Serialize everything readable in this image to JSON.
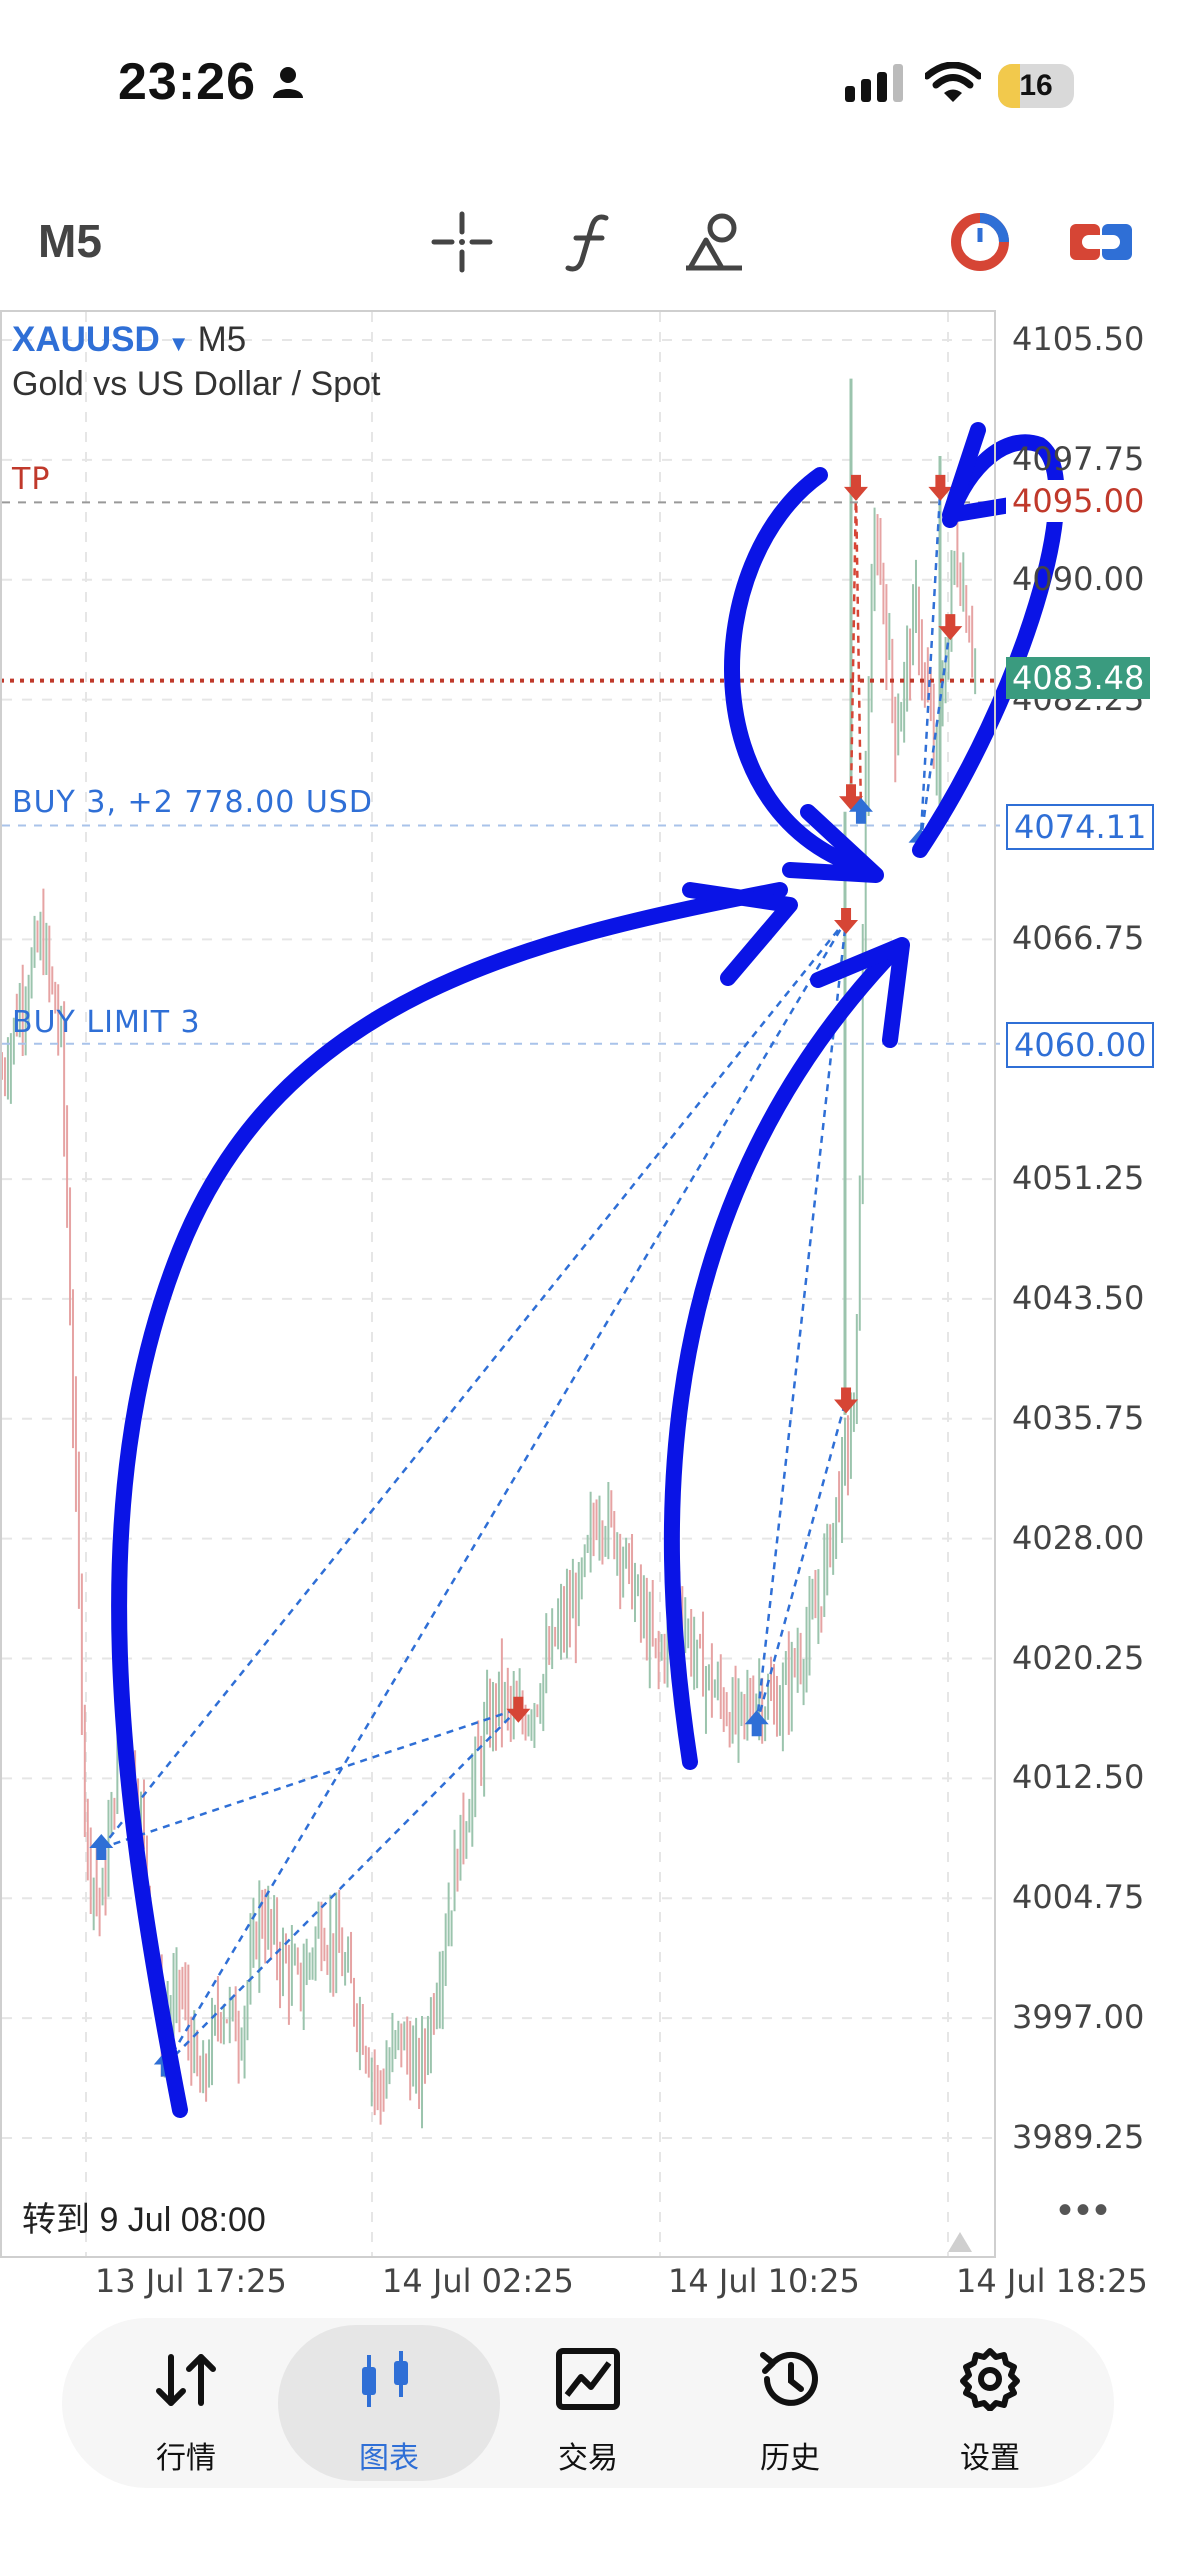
{
  "status_bar": {
    "time": "23:26",
    "battery": "16",
    "icons": [
      "person-icon",
      "cellular-signal-icon",
      "wifi-icon",
      "battery-icon"
    ]
  },
  "toolbar": {
    "timeframe": "M5",
    "icons": [
      "crosshair-icon",
      "indicators-icon",
      "objects-icon",
      "one-click-trading-icon",
      "chart-settings-icon"
    ]
  },
  "chart": {
    "symbol": "XAUUSD",
    "symbol_arrow": "▼",
    "timeframe": "M5",
    "description": "Gold vs US Dollar / Spot",
    "levels": {
      "tp_label": "TP",
      "tp_price": "4095.00",
      "bid_price": "4083.48",
      "buy_label": "BUY 3, +2 778.00 USD",
      "buy_price": "4074.11",
      "buy_limit_label": "BUY LIMIT 3",
      "buy_limit_price": "4060.00"
    },
    "price_ticks": [
      "4105.50",
      "4097.75",
      "4090.00",
      "4082.25",
      "4066.75",
      "4051.25",
      "4043.50",
      "4035.75",
      "4028.00",
      "4020.25",
      "4012.50",
      "4004.75",
      "3997.00",
      "3989.25"
    ],
    "time_ticks": [
      "13 Jul 17:25",
      "14 Jul 02:25",
      "14 Jul 10:25",
      "14 Jul 18:25"
    ],
    "goto_text": "转到 9 Jul 08:00",
    "more": "•••",
    "colors": {
      "bull": "#9bc4ad",
      "bear": "#e6a3a3",
      "buy": "#2f6fd6",
      "sell": "#d64535",
      "bid": "#3a9b7f",
      "annotation": "#0a14e6"
    }
  },
  "chart_data": {
    "type": "candlestick",
    "title": "",
    "x": [
      "13 Jul 17:25",
      "14 Jul 02:25",
      "14 Jul 10:25",
      "14 Jul 18:25"
    ],
    "ylim": [
      3985.5,
      4108
    ],
    "close_path": [
      [
        0,
        4058
      ],
      [
        0.02,
        4063
      ],
      [
        0.04,
        4067
      ],
      [
        0.06,
        4060
      ],
      [
        0.07,
        4040
      ],
      [
        0.085,
        4008
      ],
      [
        0.1,
        4004
      ],
      [
        0.12,
        4016
      ],
      [
        0.14,
        4010
      ],
      [
        0.16,
        3996
      ],
      [
        0.18,
        3999
      ],
      [
        0.2,
        3992
      ],
      [
        0.22,
        3998
      ],
      [
        0.24,
        3996
      ],
      [
        0.26,
        4004
      ],
      [
        0.28,
        4001
      ],
      [
        0.3,
        3999
      ],
      [
        0.32,
        4003
      ],
      [
        0.34,
        4001
      ],
      [
        0.36,
        3997
      ],
      [
        0.38,
        3992
      ],
      [
        0.4,
        3996
      ],
      [
        0.42,
        3993
      ],
      [
        0.44,
        4000
      ],
      [
        0.46,
        4008
      ],
      [
        0.48,
        4014
      ],
      [
        0.5,
        4018
      ],
      [
        0.52,
        4016
      ],
      [
        0.54,
        4018
      ],
      [
        0.56,
        4022
      ],
      [
        0.58,
        4024
      ],
      [
        0.6,
        4030
      ],
      [
        0.62,
        4028
      ],
      [
        0.64,
        4024
      ],
      [
        0.66,
        4020
      ],
      [
        0.68,
        4024
      ],
      [
        0.7,
        4020
      ],
      [
        0.72,
        4018
      ],
      [
        0.74,
        4016
      ],
      [
        0.76,
        4018
      ],
      [
        0.78,
        4017
      ],
      [
        0.8,
        4020
      ],
      [
        0.82,
        4023
      ],
      [
        0.84,
        4030
      ],
      [
        0.86,
        4037
      ],
      [
        0.87,
        4078
      ],
      [
        0.875,
        4086
      ],
      [
        0.88,
        4094
      ],
      [
        0.9,
        4080
      ],
      [
        0.92,
        4088
      ],
      [
        0.94,
        4078
      ],
      [
        0.96,
        4092
      ],
      [
        0.98,
        4085
      ]
    ],
    "trades": [
      {
        "side": "buy",
        "x": 0.1,
        "y": 4008
      },
      {
        "side": "buy",
        "x": 0.165,
        "y": 3994
      },
      {
        "side": "sell",
        "x": 0.52,
        "y": 4017
      },
      {
        "side": "sell",
        "x": 0.85,
        "y": 4068
      },
      {
        "side": "buy",
        "x": 0.76,
        "y": 4016
      },
      {
        "side": "sell",
        "x": 0.85,
        "y": 4037
      },
      {
        "side": "sell",
        "x": 0.855,
        "y": 4076
      },
      {
        "side": "buy",
        "x": 0.865,
        "y": 4075
      },
      {
        "side": "sell",
        "x": 0.86,
        "y": 4096
      },
      {
        "side": "buy",
        "x": 0.925,
        "y": 4073
      },
      {
        "side": "sell",
        "x": 0.945,
        "y": 4096
      },
      {
        "side": "sell",
        "x": 0.955,
        "y": 4087
      }
    ],
    "grid": true
  },
  "tabs": [
    {
      "label": "行情",
      "icon": "quotes-icon"
    },
    {
      "label": "图表",
      "icon": "chart-icon",
      "active": true
    },
    {
      "label": "交易",
      "icon": "trade-icon"
    },
    {
      "label": "历史",
      "icon": "history-icon"
    },
    {
      "label": "设置",
      "icon": "settings-icon"
    }
  ]
}
